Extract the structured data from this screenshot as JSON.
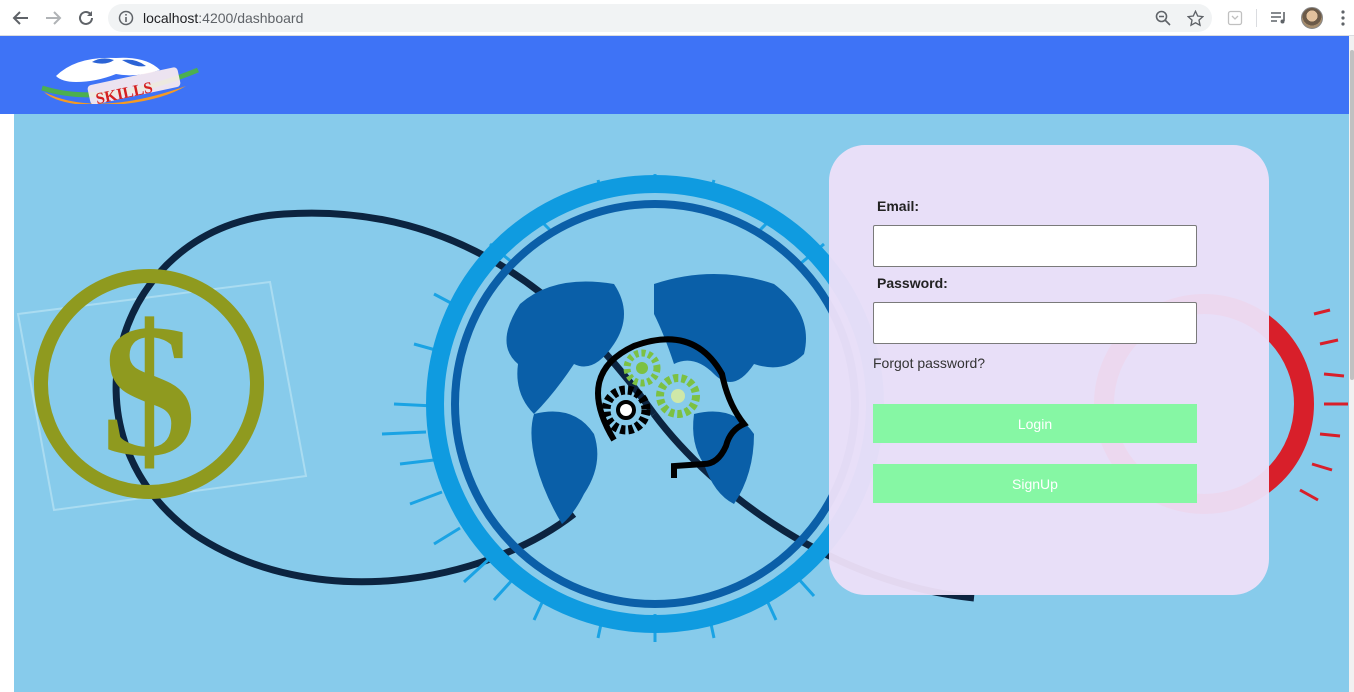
{
  "browser": {
    "url_host": "localhost",
    "url_rest": ":4200/dashboard",
    "back_icon": "back-arrow-icon",
    "forward_icon": "forward-arrow-icon",
    "reload_icon": "reload-icon"
  },
  "header": {
    "logo_text": "SKILLS",
    "bg_color": "#3e73f6"
  },
  "login": {
    "email_label": "Email:",
    "email_value": "",
    "password_label": "Password:",
    "password_value": "",
    "forgot_label": "Forgot password?",
    "login_label": "Login",
    "signup_label": "SignUp",
    "button_color": "#86f7a4"
  }
}
